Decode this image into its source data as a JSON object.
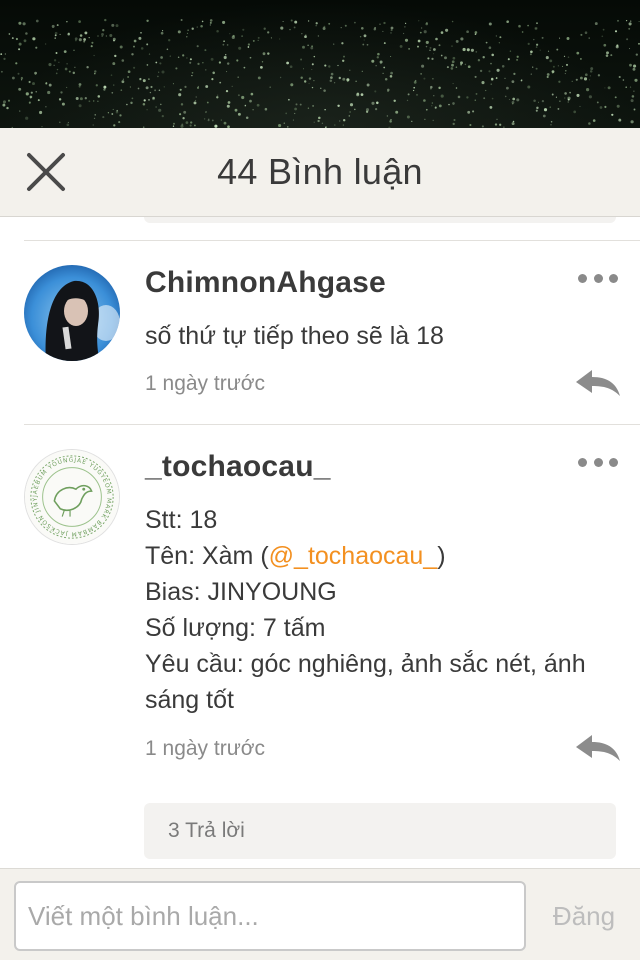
{
  "header": {
    "title": "44 Bình luận",
    "close_icon": "close-icon"
  },
  "comments": [
    {
      "username": "ChimnonAhgase",
      "avatar": "hooded-figure-avatar",
      "lines": [
        "số thứ tự tiếp theo sẽ là 18"
      ],
      "timestamp": "1 ngày trước"
    },
    {
      "username": "_tochaocau_",
      "avatar": "bird-emblem-avatar",
      "avatar_ring_text": "JAEBUM YOUNGJAE YUGYEOM MARK BAMBAM JACKSON JINYOUNG",
      "lines": [
        "Stt: 18",
        "Bias: JINYOUNG",
        "Số lượng: 7 tấm",
        "Yêu cầu: góc nghiêng, ảnh sắc nét, ánh",
        "sáng tốt"
      ],
      "name_line": {
        "prefix": "Tên: Xàm (",
        "mention": "@_tochaocau_",
        "suffix": ")"
      },
      "timestamp": "1 ngày trước",
      "replies_label": "3 Trả lời"
    }
  ],
  "composer": {
    "placeholder": "Viết một bình luận...",
    "post_label": "Đăng"
  },
  "colors": {
    "header_bg": "#f3f1ec",
    "mention": "#f39020",
    "text": "#3a3a3a",
    "muted": "#8a8a8a"
  }
}
